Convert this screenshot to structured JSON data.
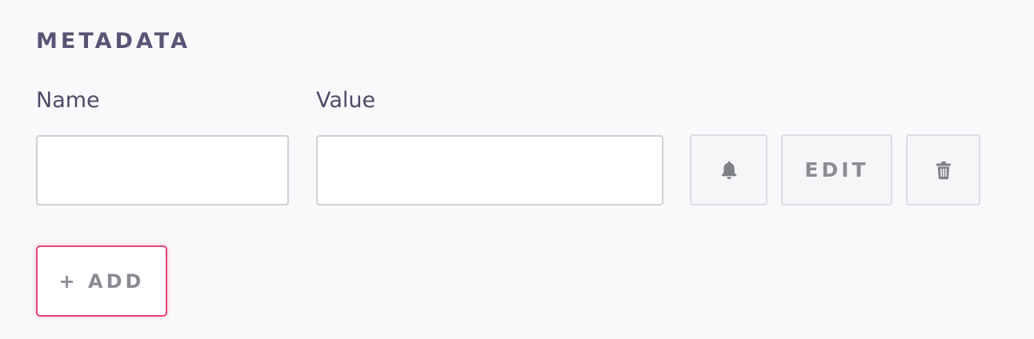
{
  "section": {
    "title": "METADATA"
  },
  "columns": {
    "name_label": "Name",
    "value_label": "Value"
  },
  "row": {
    "name_value": "",
    "name_placeholder": "",
    "value_value": "",
    "value_placeholder": "",
    "bell_icon": "bell-icon",
    "edit_label": "EDIT",
    "delete_icon": "trash-icon"
  },
  "actions": {
    "add_label": "+ ADD"
  },
  "colors": {
    "title": "#5a5474",
    "label": "#4f4a66",
    "muted_button_text": "#8a8c93",
    "focus_accent": "#e3467d",
    "background": "#f9f9fb"
  }
}
